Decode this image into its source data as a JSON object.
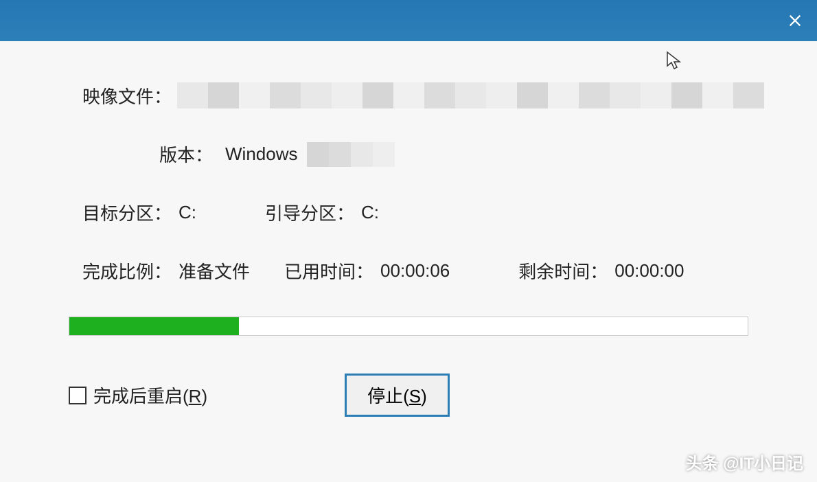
{
  "titlebar": {
    "close": "×"
  },
  "fields": {
    "image_file_label": "映像文件：",
    "version_label": "版本：",
    "version_value": "Windows",
    "target_partition_label": "目标分区：",
    "target_partition_value": "C:",
    "boot_partition_label": "引导分区：",
    "boot_partition_value": "C:",
    "progress_label": "完成比例：",
    "progress_value": "准备文件",
    "elapsed_label": "已用时间：",
    "elapsed_value": "00:00:06",
    "remaining_label": "剩余时间：",
    "remaining_value": "00:00:00"
  },
  "progress": {
    "percent": 25
  },
  "controls": {
    "restart_checkbox": "完成后重启(R)",
    "stop_button": "停止(S)"
  },
  "watermark": "头条 @IT小日记"
}
